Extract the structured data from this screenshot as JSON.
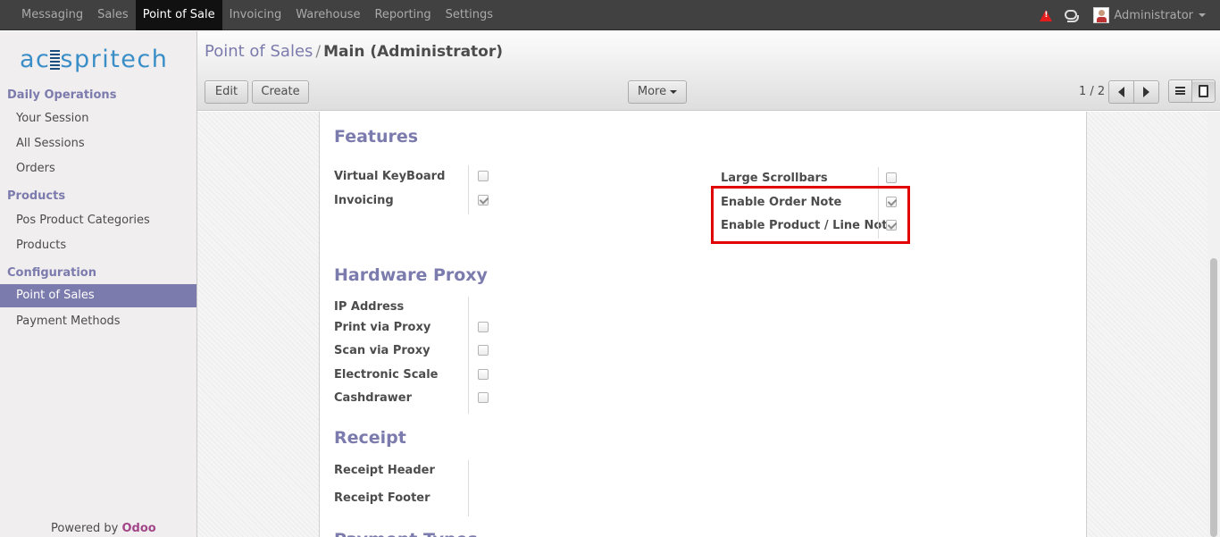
{
  "topbar": {
    "menu": [
      "Messaging",
      "Sales",
      "Point of Sale",
      "Invoicing",
      "Warehouse",
      "Reporting",
      "Settings"
    ],
    "active_menu": "Point of Sale",
    "user_name": "Administrator"
  },
  "sidebar": {
    "logo_text_left": "ac",
    "logo_text_right": "spritech",
    "sections": [
      {
        "heading": "Daily Operations",
        "items": [
          "Your Session",
          "All Sessions",
          "Orders"
        ]
      },
      {
        "heading": "Products",
        "items": [
          "Pos Product Categories",
          "Products"
        ]
      },
      {
        "heading": "Configuration",
        "items": [
          "Point of Sales",
          "Payment Methods"
        ]
      }
    ],
    "active_item": "Point of Sales",
    "powered_by": "Powered by",
    "odoo": "Odoo"
  },
  "control_panel": {
    "breadcrumb_parent": "Point of Sales",
    "breadcrumb_sep": "/",
    "breadcrumb_current": "Main (Administrator)",
    "edit_label": "Edit",
    "create_label": "Create",
    "more_label": "More",
    "pager": "1 / 2"
  },
  "form": {
    "features": {
      "title": "Features",
      "left": [
        {
          "label": "Virtual KeyBoard",
          "checked": false
        },
        {
          "label": "Invoicing",
          "checked": true
        }
      ],
      "right": [
        {
          "label": "Large Scrollbars",
          "checked": false
        },
        {
          "label": "Enable Order Note",
          "checked": true
        },
        {
          "label": "Enable Product / Line Note",
          "checked": true
        }
      ]
    },
    "hardware": {
      "title": "Hardware Proxy",
      "fields": [
        {
          "label": "IP Address"
        },
        {
          "label": "Print via Proxy",
          "checked": false
        },
        {
          "label": "Scan via Proxy",
          "checked": false
        },
        {
          "label": "Electronic Scale",
          "checked": false
        },
        {
          "label": "Cashdrawer",
          "checked": false
        }
      ]
    },
    "receipt": {
      "title": "Receipt",
      "fields": [
        "Receipt Header",
        "Receipt Footer"
      ]
    },
    "next_section_partial": "Payment Types"
  },
  "colors": {
    "accent": "#7c7bad",
    "highlight": "#e00000",
    "topbar": "#414141"
  }
}
